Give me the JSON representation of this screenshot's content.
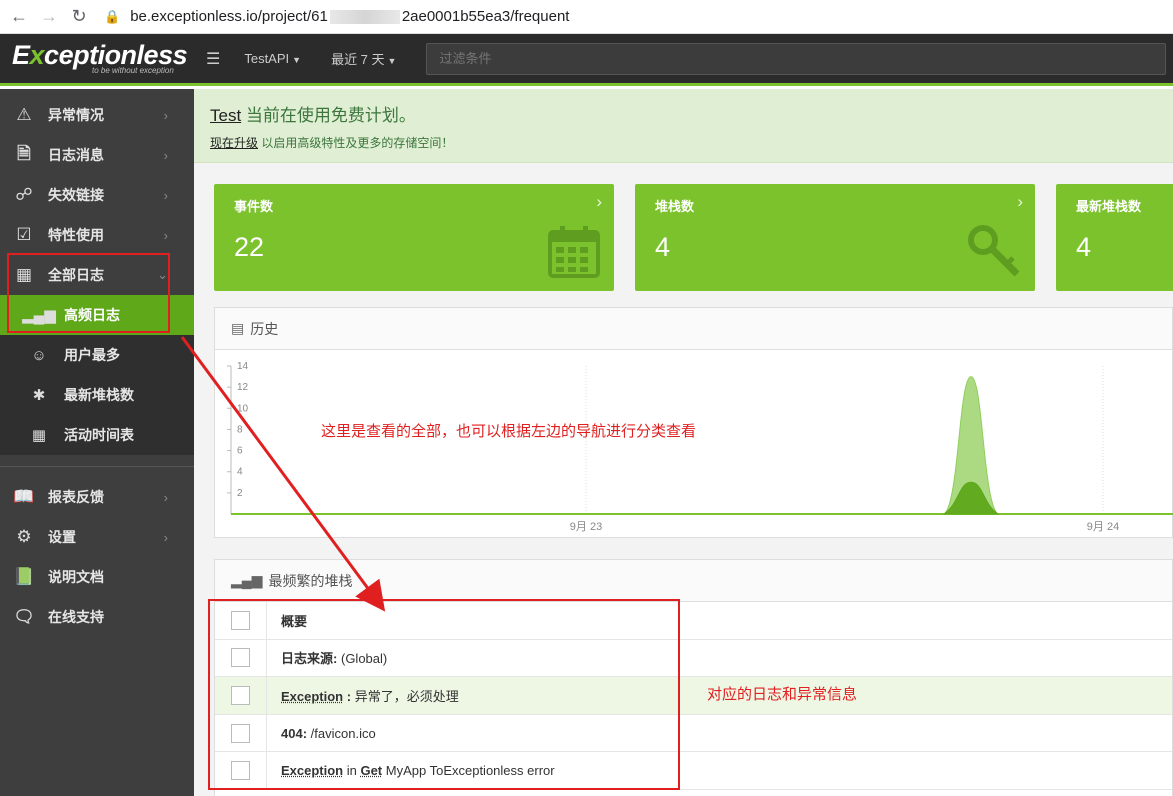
{
  "browser": {
    "url_prefix": "be.exceptionless.io/project/61",
    "url_suffix": "2ae0001b55ea3/frequent"
  },
  "header": {
    "logo_pre": "E",
    "logo_x": "x",
    "logo_rest": "ceptionless",
    "logo_tagline": "to be without exception",
    "project": "TestAPI",
    "range": "最近 7 天",
    "filter_placeholder": "过滤条件"
  },
  "sidebar": {
    "items": [
      {
        "label": "异常情况",
        "icon": "warning-icon"
      },
      {
        "label": "日志消息",
        "icon": "file-text-icon"
      },
      {
        "label": "失效链接",
        "icon": "broken-link-icon"
      },
      {
        "label": "特性使用",
        "icon": "check-square-icon"
      },
      {
        "label": "全部日志",
        "icon": "grid-icon"
      }
    ],
    "sub_items": [
      {
        "label": "高频日志",
        "icon": "signal-bars-icon"
      },
      {
        "label": "用户最多",
        "icon": "users-icon"
      },
      {
        "label": "最新堆栈数",
        "icon": "asterisk-icon"
      },
      {
        "label": "活动时间表",
        "icon": "calendar-icon"
      }
    ],
    "bottom_items": [
      {
        "label": "报表反馈",
        "icon": "book-icon"
      },
      {
        "label": "设置",
        "icon": "gear-icon"
      },
      {
        "label": "说明文档",
        "icon": "docs-icon"
      },
      {
        "label": "在线支持",
        "icon": "chat-icon"
      }
    ]
  },
  "banner": {
    "link": "Test",
    "title": " 当前在使用免费计划。",
    "upgrade_link": "现在升级",
    "subtitle": " 以启用高级特性及更多的存储空间！"
  },
  "stats": [
    {
      "label": "事件数",
      "value": "22",
      "icon": "calendar-icon"
    },
    {
      "label": "堆栈数",
      "value": "4",
      "icon": "key-icon"
    },
    {
      "label": "最新堆栈数",
      "value": "4",
      "icon": ""
    }
  ],
  "history": {
    "title": "历史",
    "chart_data": {
      "type": "area",
      "title": "历史",
      "x_ticks": [
        "9月 23",
        "9月 24"
      ],
      "y_ticks": [
        2,
        4,
        6,
        8,
        10,
        12,
        14
      ],
      "ylim": [
        0,
        14
      ],
      "series": [
        {
          "values": [
            0,
            0,
            13,
            0,
            0
          ],
          "color": "#8fce5a"
        },
        {
          "values": [
            0,
            0,
            3,
            0,
            0
          ],
          "color": "#5ea819"
        }
      ]
    }
  },
  "frequent": {
    "title": "最频繁的堆栈",
    "header": "概要",
    "rows": [
      {
        "type": "日志来源",
        "sep": ":",
        "text": "(Global)"
      },
      {
        "type": "Exception",
        "sep": " :",
        "text": " 异常了，必须处理"
      },
      {
        "type": "404",
        "sep": ":",
        "text": " /favicon.ico"
      },
      {
        "type": "Exception",
        "mid": " in ",
        "method": "Get",
        "text": " MyApp ToExceptionless error"
      }
    ]
  },
  "annotations": {
    "note1": "这里是查看的全部，也可以根据左边的导航进行分类查看",
    "note2": "对应的日志和异常信息"
  }
}
